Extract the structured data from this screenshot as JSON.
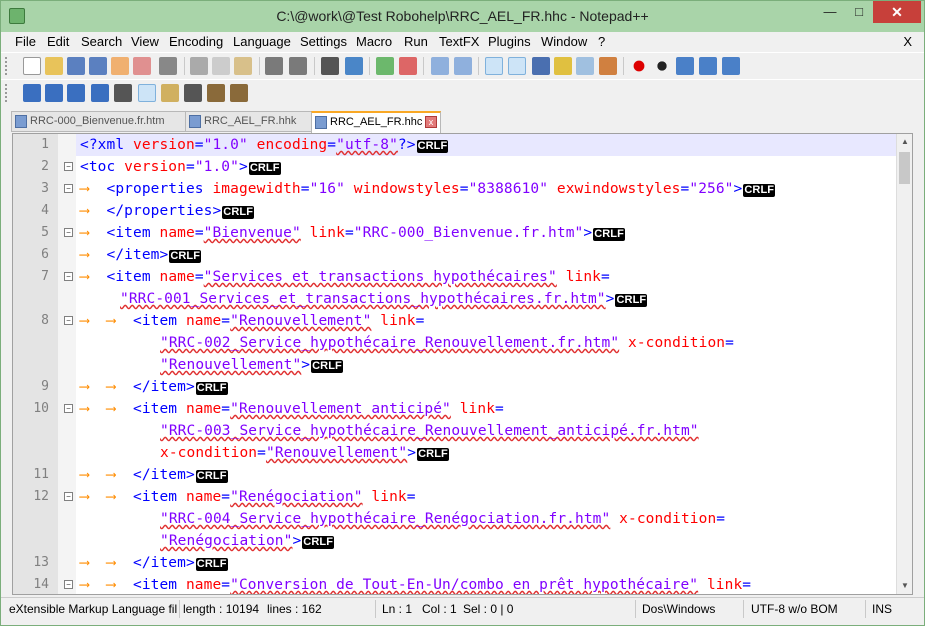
{
  "window": {
    "title": "C:\\@work\\@Test Robohelp\\RRC_AEL_FR.hhc - Notepad++",
    "min": "—",
    "max": "□",
    "close": "✕"
  },
  "menu": [
    "File",
    "Edit",
    "Search",
    "View",
    "Encoding",
    "Language",
    "Settings",
    "Macro",
    "Run",
    "TextFX",
    "Plugins",
    "Window",
    "?"
  ],
  "menu_close": "X",
  "tabs": [
    {
      "label": "RRC-000_Bienvenue.fr.htm"
    },
    {
      "label": "RRC_AEL_FR.hhk"
    },
    {
      "label": "RRC_AEL_FR.hhc",
      "active": true
    }
  ],
  "editor": {
    "line_numbers": [
      "1",
      "2",
      "3",
      "4",
      "5",
      "6",
      "7",
      "8",
      "9",
      "10",
      "11",
      "12",
      "13",
      "14"
    ],
    "crlf": "CRLF",
    "texts": {
      "l1a": "<?xml ",
      "l1b": "version",
      "l1c": "=",
      "l1d": "\"1.0\"",
      "l1e": " encoding",
      "l1f": "=",
      "l1g": "\"utf-8\"",
      "l1h": "?>",
      "l2a": "<toc ",
      "l2b": "version",
      "l2c": "=",
      "l2d": "\"1.0\"",
      "l2e": ">",
      "l3a": "<properties ",
      "l3b": "imagewidth",
      "l3d": "\"16\"",
      "l3e": " windowstyles",
      "l3g": "\"8388610\"",
      "l3h": " exwindowstyles",
      "l3j": "\"256\"",
      "l3k": ">",
      "l4a": "</properties>",
      "l5a": "<item ",
      "l5b": "name",
      "l5d": "\"Bienvenue\"",
      "l5e": " link",
      "l5g": "\"RRC-000_Bienvenue.fr.htm\"",
      "l5h": ">",
      "l6a": "</item>",
      "l7a": "<item ",
      "l7b": "name",
      "l7d": "\"Services et transactions hypothécaires\"",
      "l7e": " link",
      "l7f": "=",
      "l7w": "\"RRC-001_Services_et_transactions_hypothécaires.fr.htm\"",
      "l7x": ">",
      "l8a": "<item ",
      "l8b": "name",
      "l8d": "\"Renouvellement\"",
      "l8e": " link",
      "l8f": "=",
      "l8w": "\"RRC-002_Service_hypothécaire_Renouvellement.fr.htm\"",
      "l8x": " x-condition",
      "l8y": "=",
      "l8z": "\"Renouvellement\"",
      "l8zz": ">",
      "l9a": "</item>",
      "l10a": "<item ",
      "l10b": "name",
      "l10d": "\"Renouvellement anticipé\"",
      "l10e": " link",
      "l10f": "=",
      "l10w": "\"RRC-003_Service_hypothécaire_Renouvellement_anticipé.fr.htm\"",
      "l10x": "x-condition",
      "l10y": "=",
      "l10z": "\"Renouvellement\"",
      "l10zz": ">",
      "l11a": "</item>",
      "l12a": "<item ",
      "l12b": "name",
      "l12d": "\"Renégociation\"",
      "l12e": " link",
      "l12f": "=",
      "l12w": "\"RRC-004_Service_hypothécaire_Renégociation.fr.htm\"",
      "l12x": " x-condition",
      "l12y": "=",
      "l12z": "\"Renégociation\"",
      "l12zz": ">",
      "l13a": "</item>",
      "l14a": "<item ",
      "l14b": "name",
      "l14d": "\"Conversion de Tout-En-Un/combo en prêt hypothécaire\"",
      "l14e": " link",
      "l14f": "=",
      "eq": "="
    }
  },
  "status": {
    "type": "eXtensible Markup Language fil",
    "length": "length : 10194",
    "lines": "lines : 162",
    "ln": "Ln : 1",
    "col": "Col : 1",
    "sel": "Sel : 0 | 0",
    "eol": "Dos\\Windows",
    "enc": "UTF-8 w/o BOM",
    "ins": "INS"
  }
}
